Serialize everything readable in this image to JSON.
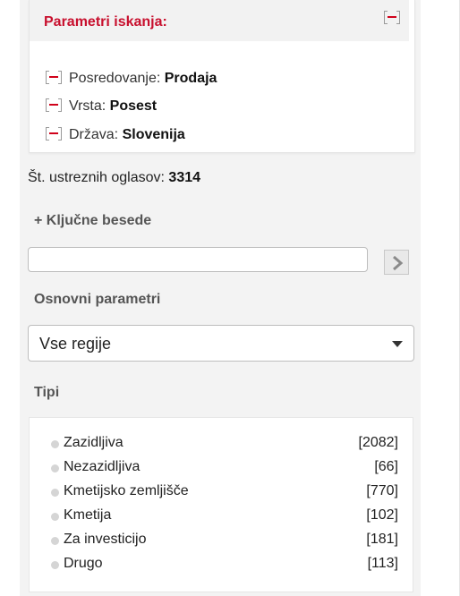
{
  "params": {
    "title": "Parametri iskanja:",
    "items": [
      {
        "label": "Posredovanje:",
        "value": "Prodaja"
      },
      {
        "label": "Vrsta:",
        "value": "Posest"
      },
      {
        "label": "Država:",
        "value": "Slovenija"
      }
    ]
  },
  "results": {
    "label": "Št. ustreznih oglasov:",
    "count": "3314"
  },
  "keywords": {
    "toggle_label": "+ Ključne besede",
    "input_value": "",
    "placeholder": ""
  },
  "basic": {
    "title": "Osnovni parametri",
    "region_selected": "Vse regije"
  },
  "types": {
    "title": "Tipi",
    "items": [
      {
        "name": "Zazidljiva",
        "count": "[2082]"
      },
      {
        "name": "Nezazidljiva",
        "count": "[66]"
      },
      {
        "name": "Kmetijsko zemljišče",
        "count": "[770]"
      },
      {
        "name": "Kmetija",
        "count": "[102]"
      },
      {
        "name": "Za investicijo",
        "count": "[181]"
      },
      {
        "name": "Drugo",
        "count": "[113]"
      }
    ]
  },
  "colors": {
    "accent": "#c8102e",
    "sidebar_bg": "#f3f3f3"
  },
  "icons": {
    "remove": "minus-bracket-icon",
    "submit": "chevron-right-icon",
    "dropdown": "caret-down-icon",
    "bullet": "circle-bullet-icon"
  }
}
